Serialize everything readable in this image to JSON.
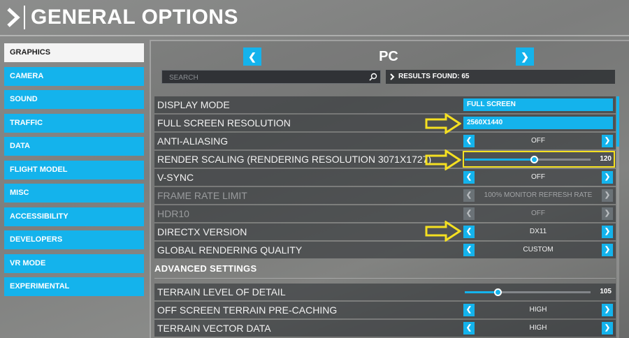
{
  "header": {
    "title": "GENERAL OPTIONS"
  },
  "sidebar": {
    "items": [
      {
        "label": "GRAPHICS",
        "active": true
      },
      {
        "label": "CAMERA"
      },
      {
        "label": "SOUND"
      },
      {
        "label": "TRAFFIC"
      },
      {
        "label": "DATA"
      },
      {
        "label": "FLIGHT MODEL"
      },
      {
        "label": "MISC"
      },
      {
        "label": "ACCESSIBILITY"
      },
      {
        "label": "DEVELOPERS"
      },
      {
        "label": "VR MODE"
      },
      {
        "label": "EXPERIMENTAL"
      }
    ]
  },
  "platform": {
    "label": "PC",
    "prev_icon": "chevron-left-icon",
    "next_icon": "chevron-right-icon"
  },
  "search": {
    "placeholder": "SEARCH",
    "value": "",
    "icon": "search-icon"
  },
  "results": {
    "text": "RESULTS FOUND: 65"
  },
  "settings": {
    "display_mode": {
      "label": "DISPLAY MODE",
      "value": "FULL SCREEN"
    },
    "full_screen_resolution": {
      "label": "FULL SCREEN RESOLUTION",
      "value": "2560X1440"
    },
    "anti_aliasing": {
      "label": "ANTI-ALIASING",
      "value": "OFF"
    },
    "render_scaling": {
      "label": "RENDER SCALING (RENDERING RESOLUTION 3071X1727)",
      "value": "120",
      "level": 0.55
    },
    "v_sync": {
      "label": "V-SYNC",
      "value": "OFF"
    },
    "frame_rate_limit": {
      "label": "FRAME RATE LIMIT",
      "value": "100% MONITOR REFRESH RATE",
      "disabled": true
    },
    "hdr10": {
      "label": "HDR10",
      "value": "OFF",
      "disabled": true
    },
    "directx_version": {
      "label": "DIRECTX VERSION",
      "value": "DX11"
    },
    "global_rendering_quality": {
      "label": "GLOBAL RENDERING QUALITY",
      "value": "CUSTOM"
    }
  },
  "advanced": {
    "title": "ADVANCED SETTINGS",
    "terrain_lod": {
      "label": "TERRAIN LEVEL OF DETAIL",
      "value": "105",
      "level": 0.26
    },
    "terrain_precaching": {
      "label": "OFF SCREEN TERRAIN PRE-CACHING",
      "value": "HIGH"
    },
    "terrain_vector_data": {
      "label": "TERRAIN VECTOR DATA",
      "value": "HIGH"
    }
  },
  "colors": {
    "accent": "#14b3ec",
    "highlight": "#f5e021",
    "active_tab": "#f4f4f4"
  }
}
